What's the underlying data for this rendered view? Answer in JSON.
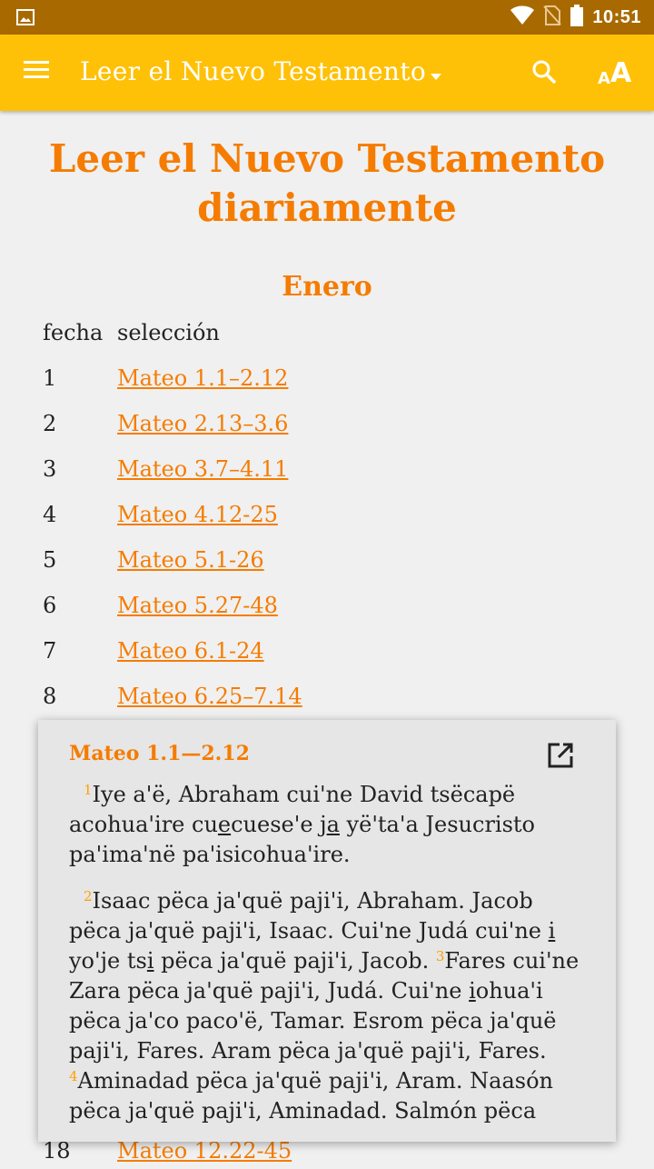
{
  "status_bar": {
    "time": "10:51",
    "icons": [
      "image-icon",
      "wifi-icon",
      "no-sim-icon",
      "battery-icon"
    ]
  },
  "app_bar": {
    "title": "Leer el Nuevo Testamento",
    "icons": [
      "menu-icon",
      "dropdown-arrow-icon",
      "search-icon",
      "text-size-icon"
    ]
  },
  "page": {
    "title_line1": "Leer el Nuevo Testamento",
    "title_line2": "diariamente",
    "month": "Enero",
    "header": {
      "col1": "fecha",
      "col2": "selección"
    },
    "rows": [
      {
        "day": "1",
        "link": "Mateo 1.1–2.12"
      },
      {
        "day": "2",
        "link": "Mateo 2.13–3.6"
      },
      {
        "day": "3",
        "link": "Mateo 3.7–4.11"
      },
      {
        "day": "4",
        "link": "Mateo 4.12-25"
      },
      {
        "day": "5",
        "link": "Mateo 5.1-26"
      },
      {
        "day": "6",
        "link": "Mateo 5.27-48"
      },
      {
        "day": "7",
        "link": "Mateo 6.1-24"
      },
      {
        "day": "8",
        "link": "Mateo 6.25–7.14"
      }
    ],
    "partial_row": {
      "day": "18",
      "link": "Mateo 12.22-45"
    }
  },
  "popup": {
    "reference": "Mateo 1.1—2.12",
    "v1_num": "1",
    "v1_a": "Iye a'ë, Abraham cui'ne David tsëcapë acohua'ire cu",
    "v1_u1": "e",
    "v1_b": "cuese'e j",
    "v1_u2": "a",
    "v1_c": " yë'ta'a Jesucristo pa'ima'në pa'isicohua'ire.",
    "v2_num": "2",
    "v2_a": "Isaac pëca ja'quë paji'i, Abraham. Jacob pëca ja'quë paji'i, Isaac. Cui'ne Judá cui'ne ",
    "v2_u1": "i",
    "v2_b": " yo'je ts",
    "v2_u2": "i",
    "v2_c": " pëca ja'quë paji'i, Jacob. ",
    "v3_num": "3",
    "v3_a": "Fares cui'ne Zara pëca ja'quë paji'i, Judá. Cui'ne ",
    "v3_u1": "i",
    "v3_b": "ohua'i pëca ja'co paco'ë, Tamar. Esrom pëca ja'quë paji'i, Fares. Aram pëca ja'quë paji'i, Fares.",
    "v4_num": "4",
    "v4_a": "Aminadad pëca ja'quë paji'i, Aram. Naasón pëca ja'quë paji'i, Aminadad. Salmón pëca"
  }
}
